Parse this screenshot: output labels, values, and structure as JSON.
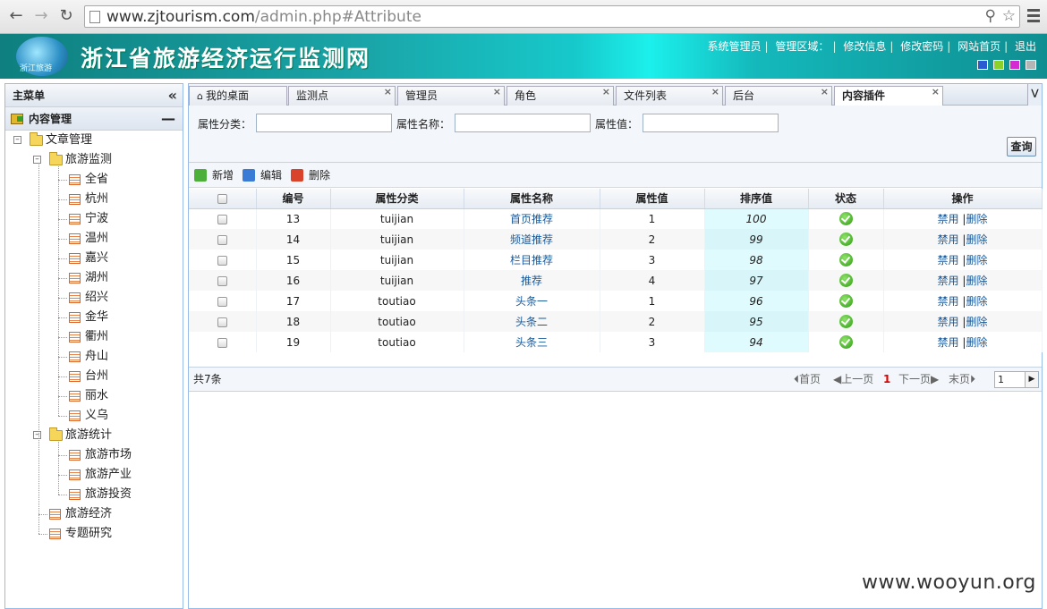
{
  "browser": {
    "url_host": "www.zjtourism.com",
    "url_path": "/admin.php#Attribute"
  },
  "header": {
    "logo_text": "浙江旅游",
    "site_title": "浙江省旅游经济运行监测网",
    "links": [
      "系统管理员",
      "管理区域：",
      "修改信息",
      "修改密码",
      "网站首页",
      "退出"
    ],
    "skin_colors": [
      "#2a5bd0",
      "#8bd12a",
      "#d42ad1",
      "#b5b5b5"
    ]
  },
  "sidebar": {
    "title": "主菜单",
    "section": "内容管理",
    "tree": {
      "root": "文章管理",
      "monitor": "旅游监测",
      "cities": [
        "全省",
        "杭州",
        "宁波",
        "温州",
        "嘉兴",
        "湖州",
        "绍兴",
        "金华",
        "衢州",
        "舟山",
        "台州",
        "丽水",
        "义乌"
      ],
      "stats": "旅游统计",
      "stats_items": [
        "旅游市场",
        "旅游产业",
        "旅游投资"
      ],
      "economy": "旅游经济",
      "research": "专题研究"
    }
  },
  "tabs": [
    {
      "label": "我的桌面",
      "closable": false
    },
    {
      "label": "监测点",
      "closable": true
    },
    {
      "label": "管理员",
      "closable": true
    },
    {
      "label": "角色",
      "closable": true
    },
    {
      "label": "文件列表",
      "closable": true
    },
    {
      "label": "后台",
      "closable": true
    },
    {
      "label": "内容插件",
      "closable": true,
      "active": true
    }
  ],
  "search": {
    "category_label": "属性分类：",
    "name_label": "属性名称：",
    "value_label": "属性值：",
    "category_value": "",
    "name_value": "",
    "value_value": "",
    "query_button": "查询"
  },
  "toolbar": {
    "add": "新增",
    "edit": "编辑",
    "delete": "删除"
  },
  "table": {
    "columns": [
      "编号",
      "属性分类",
      "属性名称",
      "属性值",
      "排序值",
      "状态",
      "操作"
    ],
    "rows": [
      {
        "id": "13",
        "category": "tuijian",
        "name": "首页推荐",
        "value": "1",
        "sort": "100"
      },
      {
        "id": "14",
        "category": "tuijian",
        "name": "频道推荐",
        "value": "2",
        "sort": "99"
      },
      {
        "id": "15",
        "category": "tuijian",
        "name": "栏目推荐",
        "value": "3",
        "sort": "98"
      },
      {
        "id": "16",
        "category": "tuijian",
        "name": "推荐",
        "value": "4",
        "sort": "97"
      },
      {
        "id": "17",
        "category": "toutiao",
        "name": "头条一",
        "value": "1",
        "sort": "96"
      },
      {
        "id": "18",
        "category": "toutiao",
        "name": "头条二",
        "value": "2",
        "sort": "95"
      },
      {
        "id": "19",
        "category": "toutiao",
        "name": "头条三",
        "value": "3",
        "sort": "94"
      }
    ],
    "action_disable": "禁用",
    "action_sep": "|",
    "action_delete": "删除"
  },
  "pager": {
    "total": "共7条",
    "first": "首页",
    "prev": "上一页",
    "current": "1",
    "next": "下一页",
    "last": "末页",
    "page_input": "1"
  },
  "watermark": "www.wooyun.org"
}
